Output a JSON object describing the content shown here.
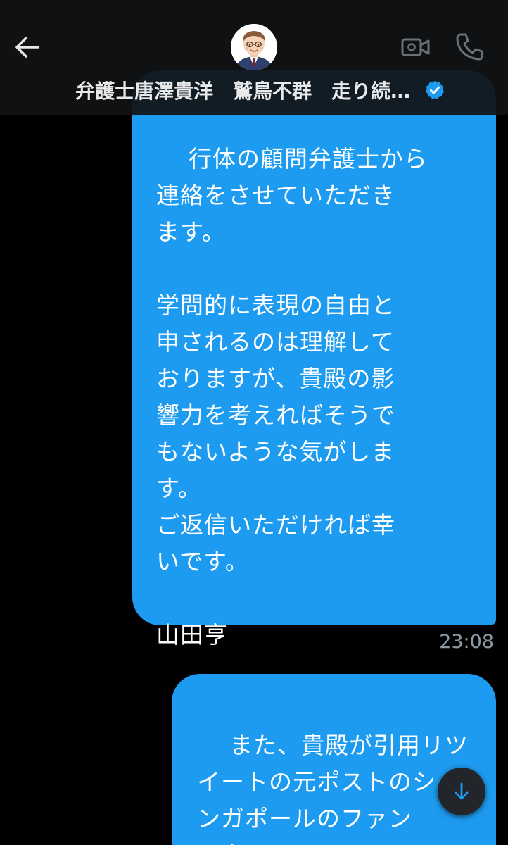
{
  "header": {
    "contact_name": "弁護士唐澤貴洋　鷲鳥不群　走り続…",
    "avatar_icon": "avatar-lawyer-illustration",
    "back_icon": "arrow-left-icon",
    "video_icon": "video-camera-icon",
    "phone_icon": "phone-icon",
    "verified_icon": "verified-badge-icon",
    "verified_color": "#1d9bf0"
  },
  "messages": [
    {
      "text": "行体の顧問弁護士から\n連絡をさせていただき\nます。\n\n学問的に表現の自由と\n申されるのは理解して\nおりますが、貴殿の影\n響力を考えればそうで\nもないような気がしま\nす。\nご返信いただければ幸\nいです。\n\n山田亨",
      "timestamp": "23:08"
    },
    {
      "text": "また、貴殿が引用リツ\nイートの元ポストのシ\nンガポールのファン\nと言うのは"
    }
  ],
  "scroll_down_icon": "arrow-down-icon",
  "colors": {
    "bubble": "#1d9bf0",
    "background": "#000000",
    "header": "#101214",
    "timestamp": "#8b98a5"
  }
}
